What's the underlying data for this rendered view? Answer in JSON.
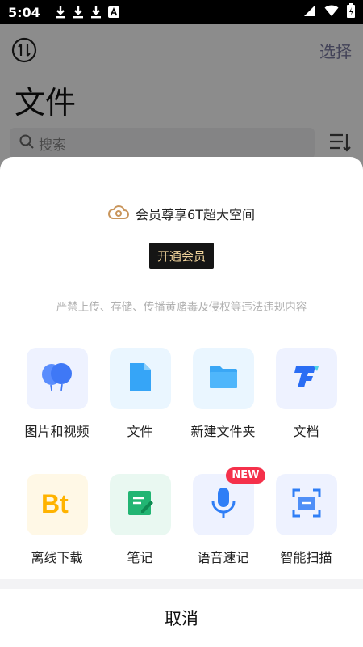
{
  "status_bar": {
    "time": "5:04",
    "notification_icons": [
      "download-icon",
      "download-icon",
      "download-icon",
      "app-a-icon"
    ],
    "right_icons": [
      "signal-icon",
      "wifi-icon",
      "battery-icon"
    ]
  },
  "background_screen": {
    "select_label": "选择",
    "title": "文件",
    "search_placeholder": "搜索"
  },
  "sheet": {
    "promo_text": "会员尊享6T超大空间",
    "vip_button_label": "开通会员",
    "notice": "严禁上传、存储、传播黄赌毒及侵权等违法违规内容",
    "items": [
      {
        "label": "图片和视频",
        "icon": "photo-video-icon",
        "tile_color": "#eef2ff"
      },
      {
        "label": "文件",
        "icon": "file-icon",
        "tile_color": "#eaf6ff"
      },
      {
        "label": "新建文件夹",
        "icon": "folder-icon",
        "tile_color": "#eaf6ff"
      },
      {
        "label": "文档",
        "icon": "document-icon",
        "tile_color": "#eef2ff"
      },
      {
        "label": "离线下载",
        "icon": "bt-download-icon",
        "tile_color": "#fff8e6"
      },
      {
        "label": "笔记",
        "icon": "note-icon",
        "tile_color": "#e9f8f1"
      },
      {
        "label": "语音速记",
        "icon": "microphone-icon",
        "tile_color": "#eef2ff",
        "badge": "NEW"
      },
      {
        "label": "智能扫描",
        "icon": "scan-icon",
        "tile_color": "#eef2ff"
      }
    ],
    "cancel_label": "取消"
  },
  "colors": {
    "vip_button_bg": "#151515",
    "vip_button_text": "#f0d39b",
    "badge_red": "#f5314b",
    "blue_accent": "#3d8bff"
  }
}
